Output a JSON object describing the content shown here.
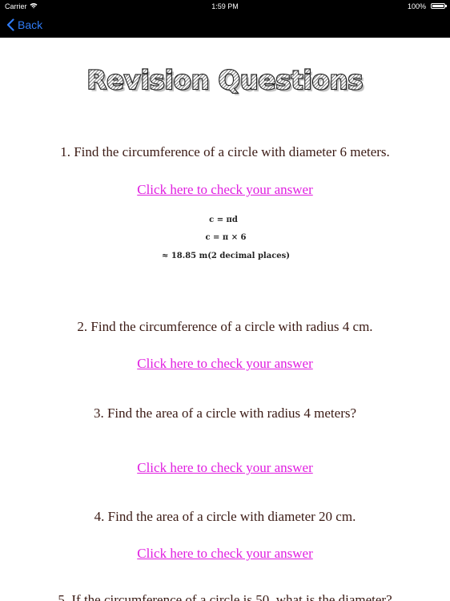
{
  "status_bar": {
    "carrier": "Carrier",
    "time": "1:59 PM",
    "battery": "100%"
  },
  "nav": {
    "back_label": "Back"
  },
  "title": "Revision Questions",
  "questions": [
    {
      "text": "1.  Find the circumference of a circle with diameter 6 meters.",
      "link": "Click here to check your answer",
      "working": [
        "c = πd",
        "c = π × 6",
        "≈  18.85 m(2 decimal places)"
      ]
    },
    {
      "text": "2. Find the circumference of a circle with radius 4 cm.",
      "link": "Click here to check your answer"
    },
    {
      "text": "3.  Find the area of a circle with radius 4 meters?",
      "link": "Click here to check your answer"
    },
    {
      "text": "4.  Find the area of a circle with diameter 20 cm.",
      "link": "Click here to check your answer"
    },
    {
      "text": "5.  If the circumference of a circle is 50, what is the diameter?"
    }
  ],
  "colors": {
    "link": "#e01ee0",
    "question_text": "#3a1a14",
    "back": "#2f7bf5"
  },
  "icons": [
    "wifi-icon",
    "battery-icon",
    "chevron-left-icon"
  ]
}
